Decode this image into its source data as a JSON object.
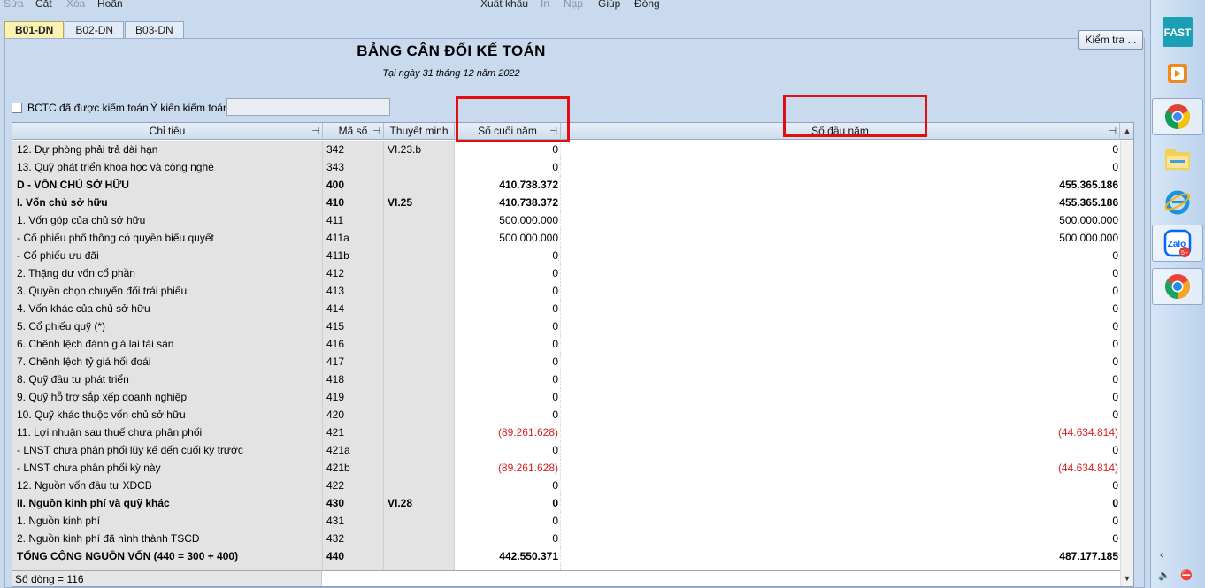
{
  "menu": {
    "items": [
      {
        "label": "Sửa",
        "dim": true
      },
      {
        "label": "Cắt",
        "dim": false
      },
      {
        "label": "Xóa",
        "dim": true
      },
      {
        "label": "Hoãn",
        "dim": false
      },
      {
        "label": "Xuất khẩu",
        "dim": false
      },
      {
        "label": "In",
        "dim": true
      },
      {
        "label": "Nạp",
        "dim": true
      },
      {
        "label": "Giúp",
        "dim": false
      },
      {
        "label": "Đóng",
        "dim": false
      }
    ]
  },
  "tabs": [
    {
      "label": "B01-DN",
      "active": true
    },
    {
      "label": "B02-DN",
      "active": false
    },
    {
      "label": "B03-DN",
      "active": false
    }
  ],
  "toolbar": {
    "check_label": "Kiểm tra ..."
  },
  "report": {
    "title": "BẢNG CÂN ĐỐI KẾ TOÁN",
    "subtitle": "Tại ngày 31 tháng 12 năm 2022",
    "audited_label": "BCTC đã được kiểm toán",
    "audit_opinion_label": "Ý kiến kiểm toán",
    "audit_opinion_value": ""
  },
  "grid": {
    "headers": {
      "name": "Chỉ tiêu",
      "code": "Mã số",
      "note": "Thuyết minh",
      "end": "Số cuối năm",
      "begin": "Số đầu năm"
    },
    "rows": [
      {
        "name": "12. Dự phòng phải trả dài hạn",
        "code": "342",
        "note": "VI.23.b",
        "end": "0",
        "begin": "0",
        "bold": false,
        "neg": false
      },
      {
        "name": "13. Quỹ phát triển khoa học và công nghệ",
        "code": "343",
        "note": "",
        "end": "0",
        "begin": "0",
        "bold": false,
        "neg": false
      },
      {
        "name": "D - VỐN CHỦ SỞ HỮU",
        "code": "400",
        "note": "",
        "end": "410.738.372",
        "begin": "455.365.186",
        "bold": true,
        "neg": false
      },
      {
        "name": "I. Vốn chủ sở hữu",
        "code": "410",
        "note": "VI.25",
        "end": "410.738.372",
        "begin": "455.365.186",
        "bold": true,
        "neg": false
      },
      {
        "name": "1. Vốn góp của chủ sở hữu",
        "code": "411",
        "note": "",
        "end": "500.000.000",
        "begin": "500.000.000",
        "bold": false,
        "neg": false
      },
      {
        "name": " - Cổ phiếu phổ thông có quyền biểu quyết",
        "code": "411a",
        "note": "",
        "end": "500.000.000",
        "begin": "500.000.000",
        "bold": false,
        "neg": false
      },
      {
        "name": " - Cổ phiếu ưu đãi",
        "code": "411b",
        "note": "",
        "end": "0",
        "begin": "0",
        "bold": false,
        "neg": false
      },
      {
        "name": "2. Thặng dư vốn cổ phần",
        "code": "412",
        "note": "",
        "end": "0",
        "begin": "0",
        "bold": false,
        "neg": false
      },
      {
        "name": "3. Quyền chọn chuyển đổi trái phiếu",
        "code": "413",
        "note": "",
        "end": "0",
        "begin": "0",
        "bold": false,
        "neg": false
      },
      {
        "name": "4. Vốn khác của chủ sở hữu",
        "code": "414",
        "note": "",
        "end": "0",
        "begin": "0",
        "bold": false,
        "neg": false
      },
      {
        "name": "5. Cổ phiếu quỹ (*)",
        "code": "415",
        "note": "",
        "end": "0",
        "begin": "0",
        "bold": false,
        "neg": false
      },
      {
        "name": "6. Chênh lệch đánh giá lại tài sản",
        "code": "416",
        "note": "",
        "end": "0",
        "begin": "0",
        "bold": false,
        "neg": false
      },
      {
        "name": "7. Chênh lệch tỷ giá hối đoái",
        "code": "417",
        "note": "",
        "end": "0",
        "begin": "0",
        "bold": false,
        "neg": false
      },
      {
        "name": "8. Quỹ đầu tư phát triển",
        "code": "418",
        "note": "",
        "end": "0",
        "begin": "0",
        "bold": false,
        "neg": false
      },
      {
        "name": "9. Quỹ hỗ trợ sắp xếp doanh nghiệp",
        "code": "419",
        "note": "",
        "end": "0",
        "begin": "0",
        "bold": false,
        "neg": false
      },
      {
        "name": "10. Quỹ khác thuộc vốn chủ sở hữu",
        "code": "420",
        "note": "",
        "end": "0",
        "begin": "0",
        "bold": false,
        "neg": false
      },
      {
        "name": "11. Lợi nhuận sau thuế chưa phân phối",
        "code": "421",
        "note": "",
        "end": "(89.261.628)",
        "begin": "(44.634.814)",
        "bold": false,
        "neg": true
      },
      {
        "name": "- LNST chưa phân phối lũy kế đến cuối kỳ trước",
        "code": "421a",
        "note": "",
        "end": "0",
        "begin": "0",
        "bold": false,
        "neg": false
      },
      {
        "name": "- LNST chưa phân phối kỳ này",
        "code": "421b",
        "note": "",
        "end": "(89.261.628)",
        "begin": "(44.634.814)",
        "bold": false,
        "neg": true
      },
      {
        "name": "12. Nguồn vốn đầu tư XDCB",
        "code": "422",
        "note": "",
        "end": "0",
        "begin": "0",
        "bold": false,
        "neg": false
      },
      {
        "name": "II. Nguồn kinh phí và quỹ khác",
        "code": "430",
        "note": "VI.28",
        "end": "0",
        "begin": "0",
        "bold": true,
        "neg": false
      },
      {
        "name": "1. Nguồn kinh phí",
        "code": "431",
        "note": "",
        "end": "0",
        "begin": "0",
        "bold": false,
        "neg": false
      },
      {
        "name": "2. Nguồn kinh phí đã hình thành TSCĐ",
        "code": "432",
        "note": "",
        "end": "0",
        "begin": "0",
        "bold": false,
        "neg": false
      },
      {
        "name": "TỔNG CỘNG NGUỒN VỐN (440 = 300 + 400)",
        "code": "440",
        "note": "",
        "end": "442.550.371",
        "begin": "487.177.185",
        "bold": true,
        "neg": false
      },
      {
        "name": "",
        "code": "",
        "note": "",
        "end": "",
        "begin": "",
        "bold": false,
        "neg": false
      }
    ],
    "row_count": "Số dòng = 116"
  },
  "taskbar": {
    "items": [
      {
        "icon": "fast-icon",
        "label": "FAST"
      },
      {
        "icon": "media-player-icon",
        "label": ""
      },
      {
        "icon": "chrome-icon",
        "label": ""
      },
      {
        "icon": "file-explorer-icon",
        "label": ""
      },
      {
        "icon": "internet-explorer-icon",
        "label": ""
      },
      {
        "icon": "zalo-icon",
        "label": "Zalo"
      },
      {
        "icon": "chrome-canary-icon",
        "label": ""
      }
    ],
    "zalo_badge": "5+"
  },
  "colors": {
    "window_bg": "#c9d9ee",
    "active_tab": "#fdf2b5",
    "negative": "#d61f1f",
    "highlight_box": "#e01010"
  }
}
